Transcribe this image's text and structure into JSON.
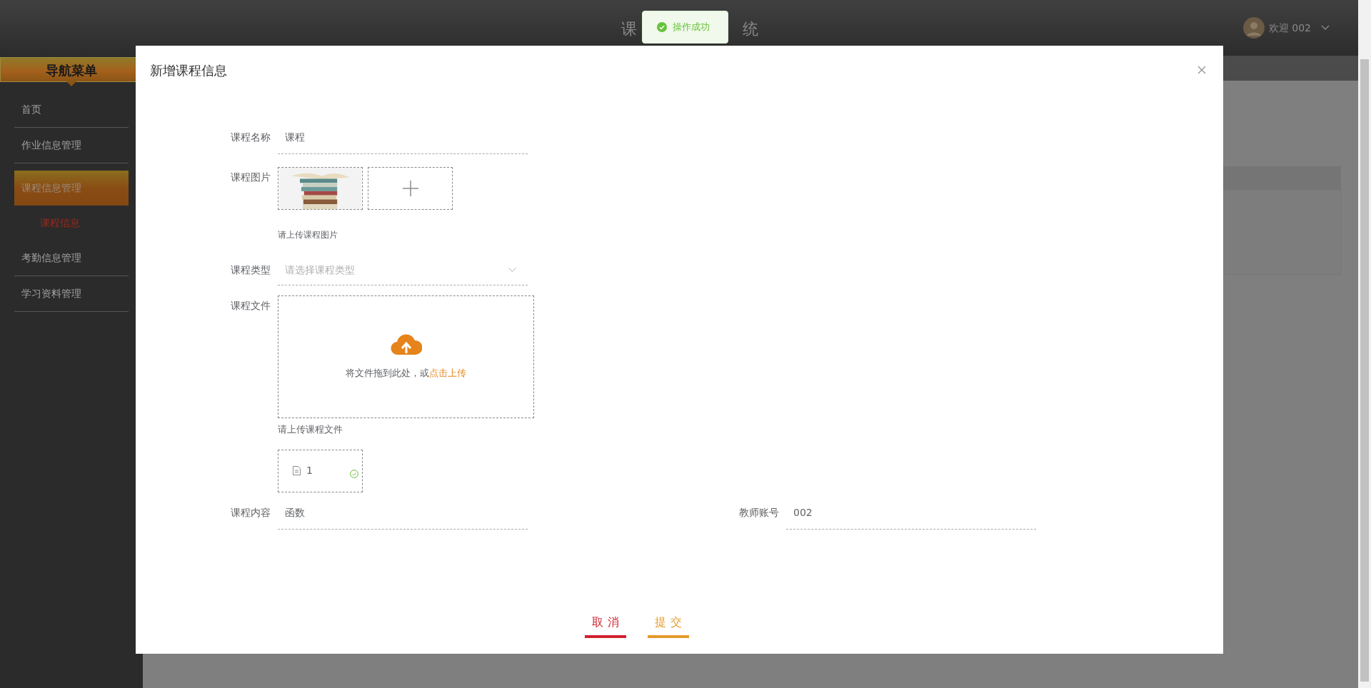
{
  "header": {
    "title_parts": [
      "课",
      "统"
    ],
    "user": {
      "greeting": "欢迎 002"
    }
  },
  "toast": {
    "message": "操作成功"
  },
  "sidebar": {
    "title": "导航菜单",
    "items": [
      {
        "label": "首页",
        "selected": false
      },
      {
        "label": "作业信息管理",
        "selected": false
      },
      {
        "label": "课程信息管理",
        "selected": true,
        "children": [
          {
            "label": "课程信息",
            "selected": true
          }
        ]
      },
      {
        "label": "考勤信息管理",
        "selected": false
      },
      {
        "label": "学习资料管理",
        "selected": false
      }
    ]
  },
  "dialog": {
    "title": "新增课程信息",
    "fields": [
      {
        "kind": "text",
        "label": "课程名称",
        "value": "课程"
      },
      {
        "label": "课程图片",
        "hint": "请上传课程图片"
      },
      {
        "kind": "select",
        "label": "课程类型",
        "placeholder": "请选择课程类型"
      },
      {
        "kind": "file",
        "label": "课程文件",
        "drop_text": "将文件拖到此处，或",
        "drop_link": "点击上传",
        "hint": "请上传课程文件",
        "files": [
          {
            "name": "1",
            "uploaded": true
          }
        ]
      }
    ],
    "bottom_fields": [
      {
        "kind": "text",
        "label": "课程内容",
        "value": "函数"
      },
      {
        "kind": "text",
        "label": "教师账号",
        "value": "002"
      }
    ],
    "buttons": [
      {
        "kind": "cancel",
        "label": "取消"
      },
      {
        "kind": "submit",
        "label": "提交"
      }
    ]
  }
}
